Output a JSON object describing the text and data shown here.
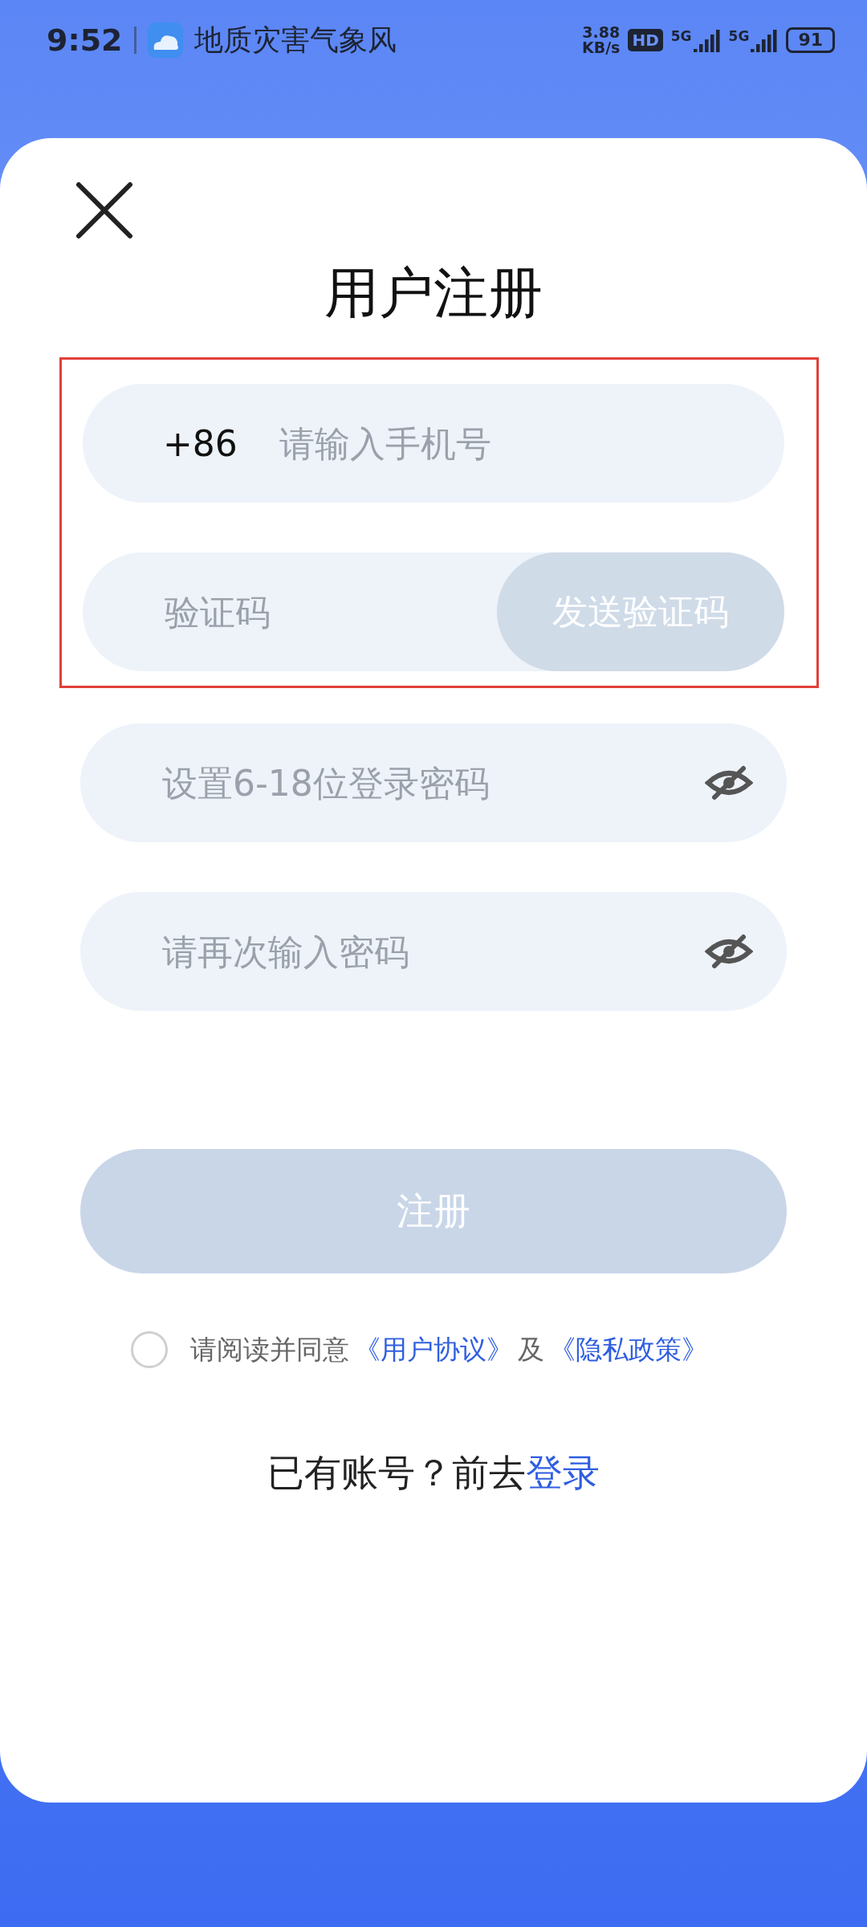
{
  "status_bar": {
    "time": "9:52",
    "app_title": "地质灾害气象风",
    "speed_value": "3.88",
    "speed_unit": "KB/s",
    "hd": "HD",
    "networks": [
      "5G",
      "5G"
    ],
    "battery": "91"
  },
  "title": "用户注册",
  "highlight_frame": true,
  "fields": [
    {
      "kind": "phone",
      "prefix": "+86",
      "placeholder": "请输入手机号"
    },
    {
      "kind": "code",
      "placeholder": "验证码",
      "button": "发送验证码"
    },
    {
      "kind": "password",
      "placeholder": "设置6-18位登录密码"
    },
    {
      "kind": "password",
      "placeholder": "请再次输入密码"
    }
  ],
  "register_button": {
    "label": "注册",
    "disabled": true
  },
  "agreement": {
    "checked": false,
    "parts": [
      {
        "kind": "text",
        "text": "请阅读并同意"
      },
      {
        "kind": "link",
        "text": "《用户协议》"
      },
      {
        "kind": "text",
        "text": "及"
      },
      {
        "kind": "link",
        "text": "《隐私政策》"
      }
    ]
  },
  "login_line": {
    "prompt": "已有账号？前去",
    "link": "登录"
  }
}
